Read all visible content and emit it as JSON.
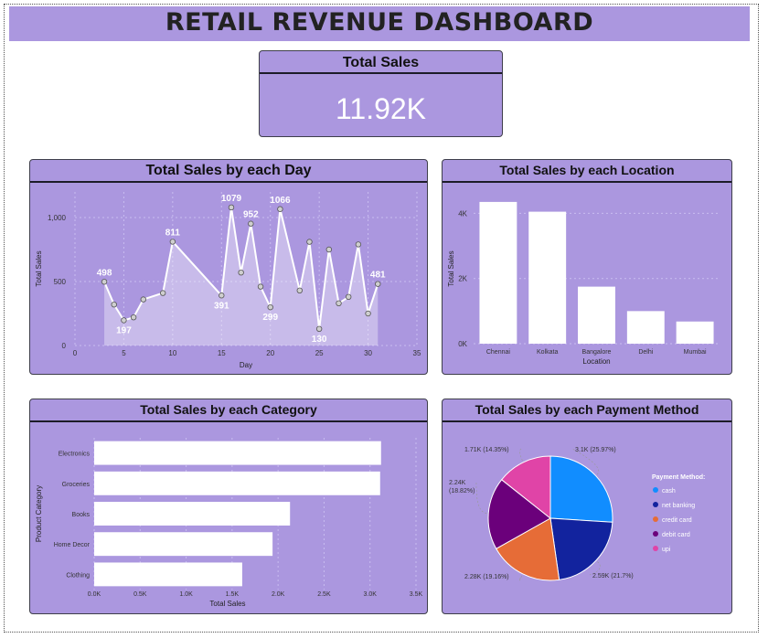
{
  "dashboard_title": "RETAIL REVENUE DASHBOARD",
  "kpi": {
    "title": "Total Sales",
    "value": "11.92K"
  },
  "colors": {
    "panel": "#ab97df",
    "bar": "#ffffff"
  },
  "chart_data": [
    {
      "type": "area",
      "title": "Total Sales by each Day",
      "xlabel": "Day",
      "ylabel": "Total Sales",
      "xlim": [
        0,
        35
      ],
      "ylim": [
        0,
        1200
      ],
      "x_ticks": [
        "0",
        "5",
        "10",
        "15",
        "20",
        "25",
        "30",
        "35"
      ],
      "y_ticks": [
        "0",
        "500",
        "1,000"
      ],
      "grid": true,
      "series": [
        {
          "x": [
            3,
            4,
            5,
            6,
            7,
            9,
            10,
            15,
            16,
            17,
            18,
            19,
            20,
            21,
            23,
            24,
            25,
            26,
            27,
            28,
            29,
            30,
            31
          ],
          "values": [
            498,
            320,
            197,
            220,
            360,
            410,
            811,
            391,
            1079,
            570,
            952,
            460,
            299,
            1066,
            430,
            810,
            130,
            750,
            330,
            380,
            790,
            250,
            481
          ]
        }
      ],
      "data_labels": [
        {
          "x": 3,
          "text": "498"
        },
        {
          "x": 5,
          "text": "197"
        },
        {
          "x": 10,
          "text": "811"
        },
        {
          "x": 15,
          "text": "391"
        },
        {
          "x": 16,
          "text": "1079"
        },
        {
          "x": 18,
          "text": "952"
        },
        {
          "x": 20,
          "text": "299"
        },
        {
          "x": 21,
          "text": "1066"
        },
        {
          "x": 25,
          "text": "130"
        },
        {
          "x": 31,
          "text": "481"
        }
      ]
    },
    {
      "type": "bar",
      "title": "Total Sales by each Location",
      "xlabel": "Location",
      "ylabel": "Total Sales",
      "categories": [
        "Chennai",
        "Kolkata",
        "Bangalore",
        "Delhi",
        "Mumbai"
      ],
      "values": [
        4350,
        4050,
        1750,
        1000,
        680
      ],
      "ylim": [
        0,
        4600
      ],
      "y_ticks": [
        {
          "v": 0,
          "label": "0K"
        },
        {
          "v": 2000,
          "label": "2K"
        },
        {
          "v": 4000,
          "label": "4K"
        }
      ],
      "grid": true
    },
    {
      "type": "bar",
      "orientation": "horizontal",
      "title": "Total Sales by each Category",
      "xlabel": "Total Sales",
      "ylabel": "Product Category",
      "categories": [
        "Electronics",
        "Groceries",
        "Books",
        "Home Decor",
        "Clothing"
      ],
      "values": [
        3120,
        3110,
        2130,
        1940,
        1610
      ],
      "xlim": [
        0,
        3500
      ],
      "x_ticks": [
        "0.0K",
        "0.5K",
        "1.0K",
        "1.5K",
        "2.0K",
        "2.5K",
        "3.0K",
        "3.5K"
      ],
      "grid": true
    },
    {
      "type": "pie",
      "title": "Total Sales by each Payment Method",
      "legend_title": "Payment Method:",
      "legend_position": "right",
      "slices": [
        {
          "name": "cash",
          "value": 3100,
          "pct": 25.97,
          "label": "3.1K (25.97%)",
          "color": "#118dff"
        },
        {
          "name": "net banking",
          "value": 2590,
          "pct": 21.7,
          "label": "2.59K (21.7%)",
          "color": "#12239e"
        },
        {
          "name": "credit card",
          "value": 2280,
          "pct": 19.16,
          "label": "2.28K (19.16%)",
          "color": "#e66c37"
        },
        {
          "name": "debit card",
          "value": 2240,
          "pct": 18.82,
          "label_lines": [
            "2.24K",
            "(18.82%)"
          ],
          "color": "#6b007b"
        },
        {
          "name": "upi",
          "value": 1710,
          "pct": 14.35,
          "label": "1.71K (14.35%)",
          "color": "#e044a7"
        }
      ]
    }
  ]
}
